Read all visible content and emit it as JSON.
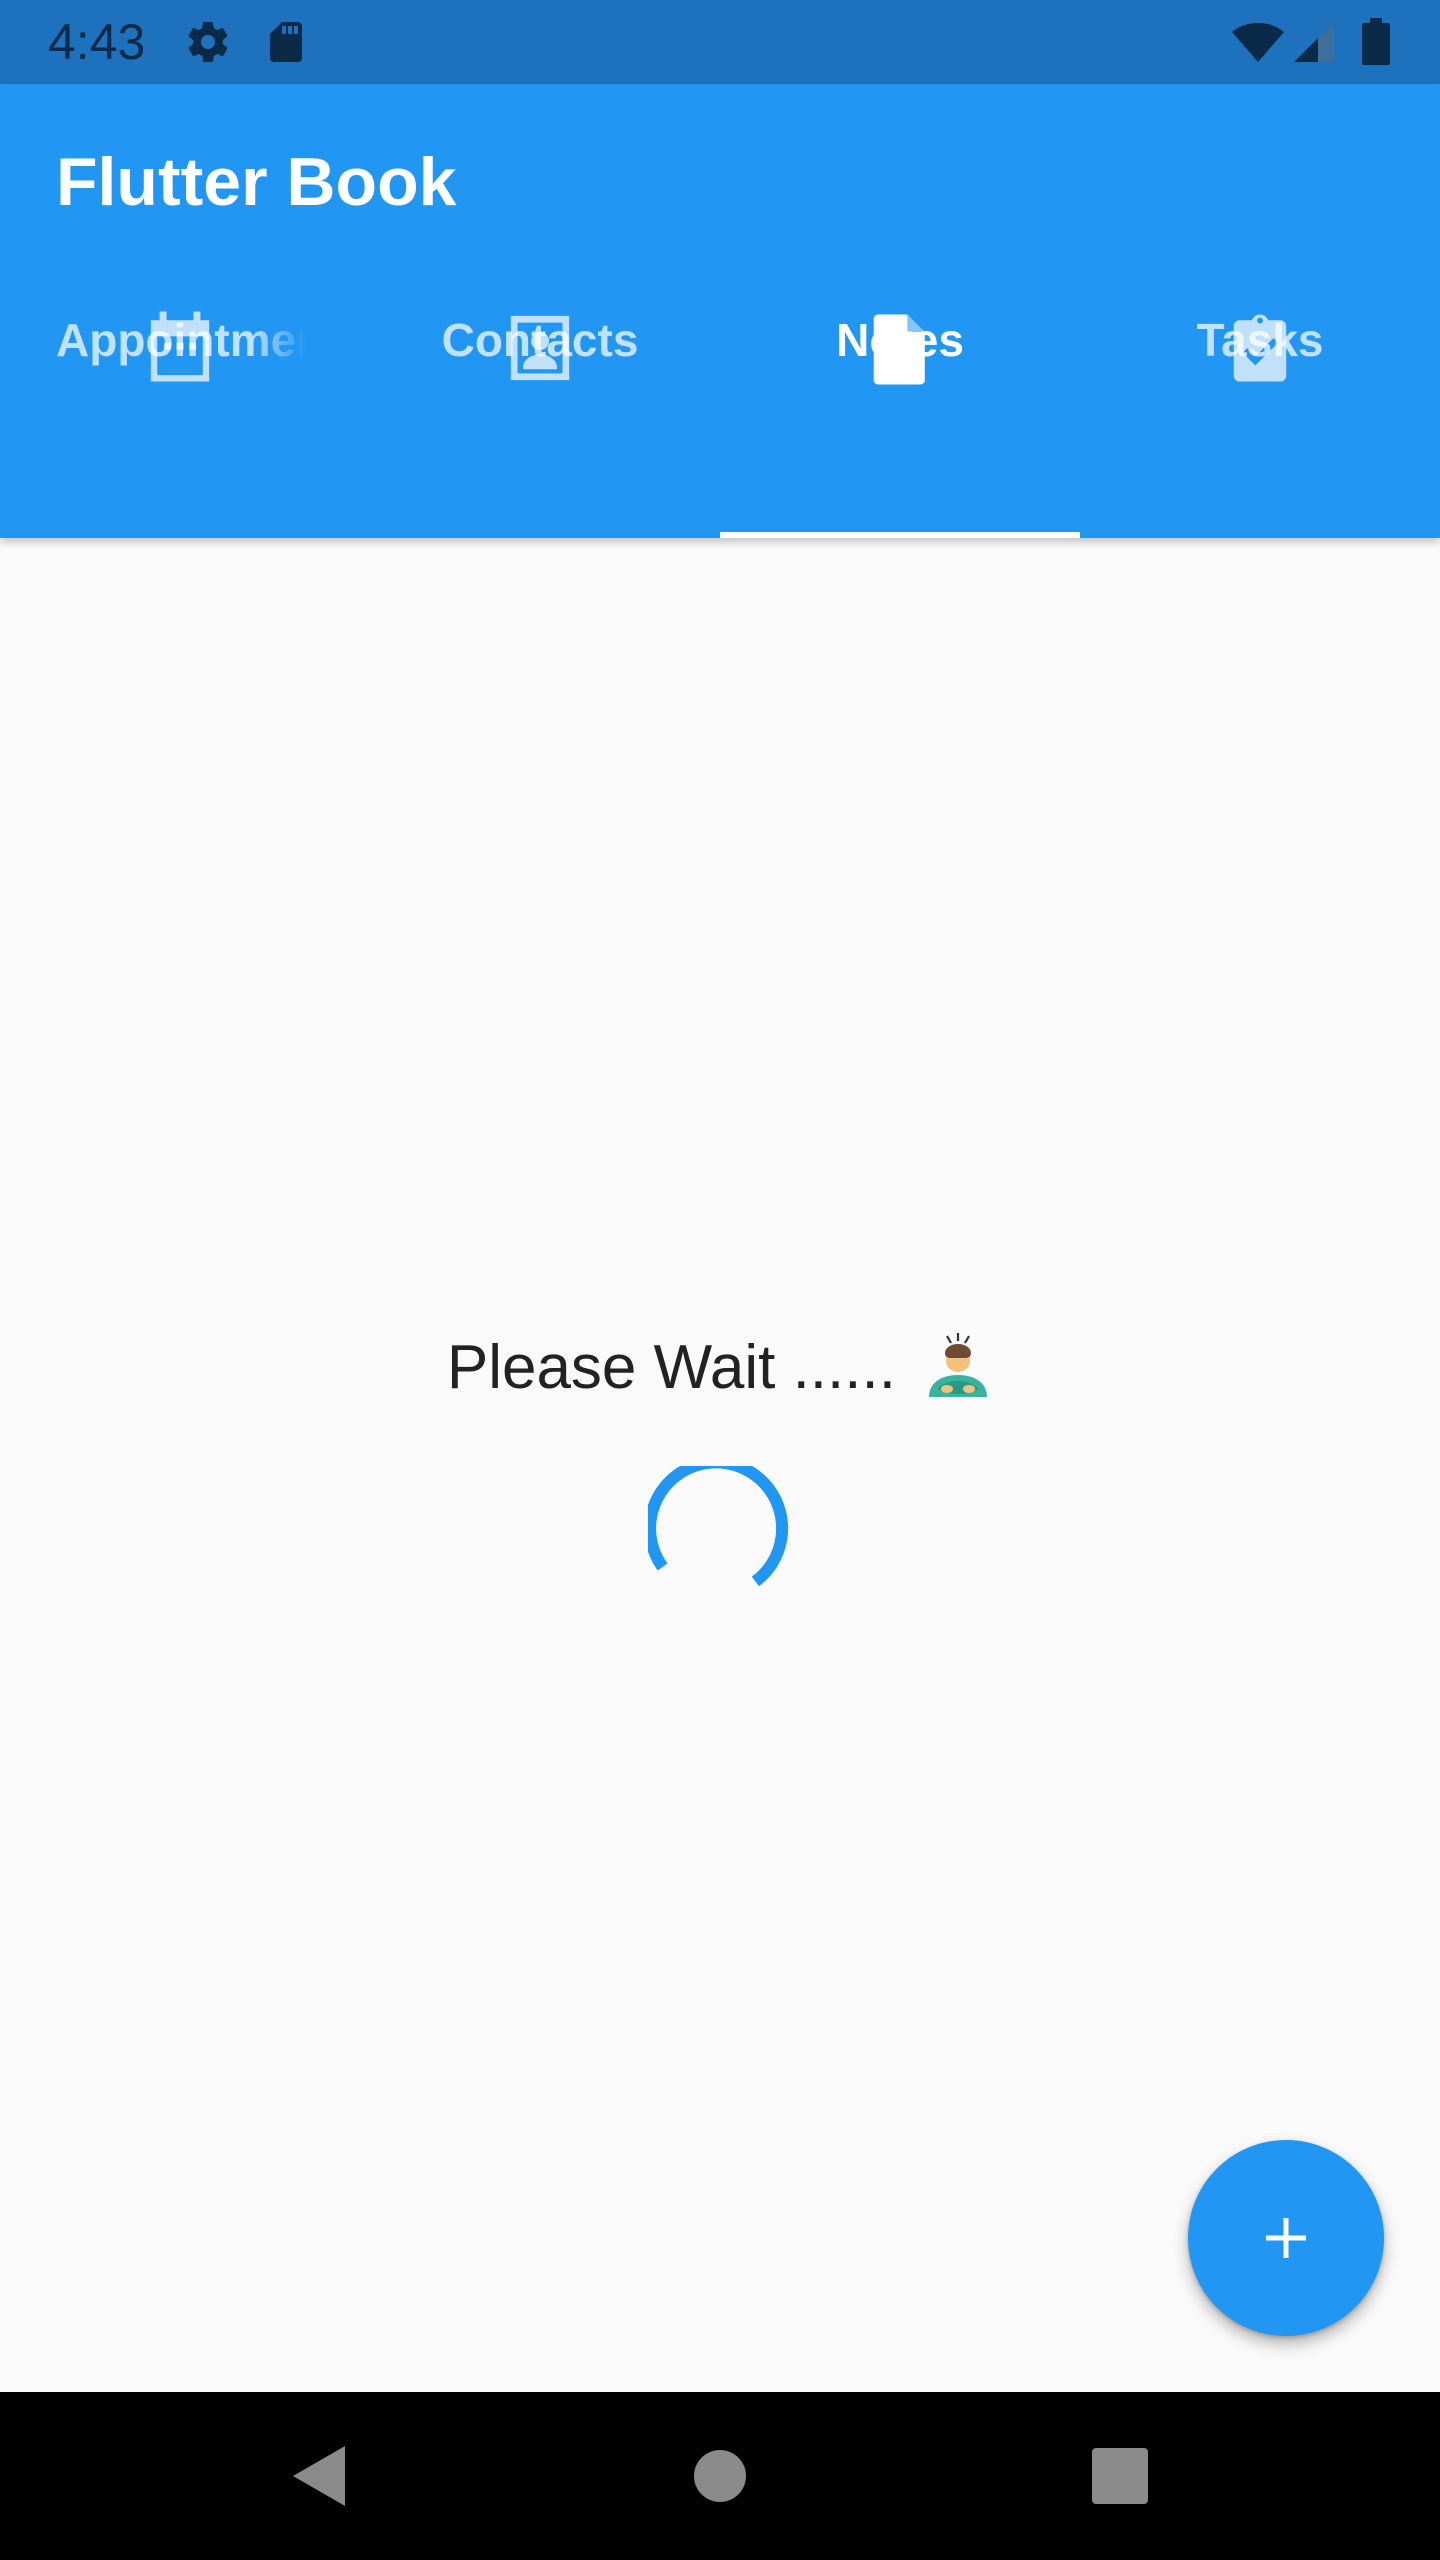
{
  "status_bar": {
    "time": "4:43",
    "icons": [
      "gear-icon",
      "sd-card-icon",
      "wifi-icon",
      "signal-icon",
      "battery-icon"
    ]
  },
  "app_bar": {
    "title": "Flutter Book"
  },
  "tabs": [
    {
      "label": "Appointments",
      "icon": "calendar-icon",
      "active": false
    },
    {
      "label": "Contacts",
      "icon": "contact-card-icon",
      "active": false
    },
    {
      "label": "Notes",
      "icon": "note-icon",
      "active": true
    },
    {
      "label": "Tasks",
      "icon": "clipboard-check-icon",
      "active": false
    }
  ],
  "content": {
    "wait_text": "Please Wait ......",
    "emoji": "person-bowing-emoji"
  },
  "fab": {
    "icon": "plus-icon"
  },
  "nav_bar": {
    "buttons": [
      "back-icon",
      "home-icon",
      "recents-icon"
    ]
  },
  "colors": {
    "status_bar": "#1e72bd",
    "app_bar": "#2196f3",
    "background": "#fafafa",
    "spinner": "#2196f3",
    "fab": "#2196f3",
    "nav_bar": "#000000"
  }
}
